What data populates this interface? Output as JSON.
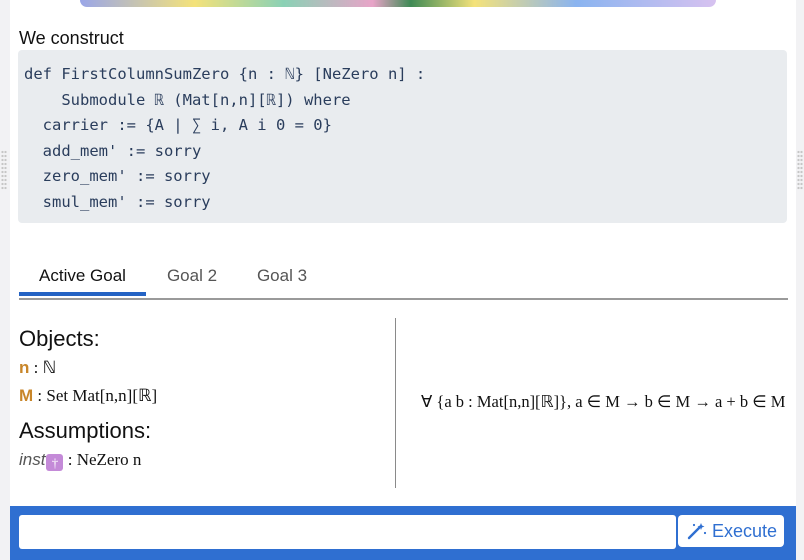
{
  "intro": "We construct",
  "code_lines": [
    "def FirstColumnSumZero {n : ℕ} [NeZero n] :",
    "    Submodule ℝ (Mat[n,n][ℝ]) where",
    "  carrier := {A | ∑ i, A i 0 = 0}",
    "  add_mem' := sorry",
    "  zero_mem' := sorry",
    "  smul_mem' := sorry"
  ],
  "tabs": [
    "Active Goal",
    "Goal 2",
    "Goal 3"
  ],
  "objects": {
    "heading": "Objects:",
    "items": [
      {
        "name": "n",
        "sep": " : ",
        "type": "ℕ"
      },
      {
        "name": "M",
        "sep": " : ",
        "type": "Set Mat[n,n][ℝ]"
      }
    ]
  },
  "assumptions": {
    "heading": "Assumptions:",
    "items": [
      {
        "name": "inst",
        "badge": "†",
        "sep": " : ",
        "type": "NeZero n"
      }
    ]
  },
  "goal": "∀ {a b : Mat[n,n][ℝ]}, a ∈ M → b ∈ M → a + b ∈ M",
  "command": {
    "input_value": "",
    "execute_label": "Execute"
  },
  "colors": {
    "accent": "#2f6fd1",
    "tab_underline": "#2463c4",
    "variable": "#c8862a",
    "badge": "#c48ad8"
  }
}
